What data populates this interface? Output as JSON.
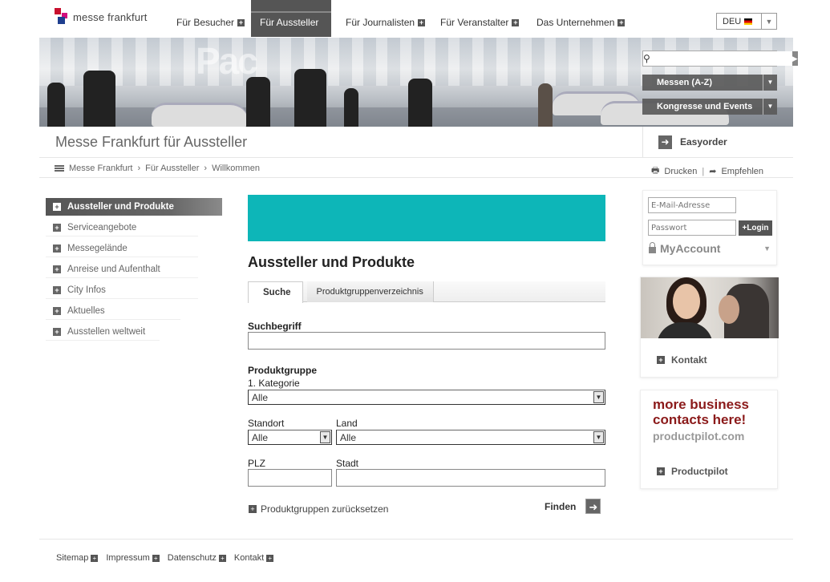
{
  "brand": {
    "name": "messe frankfurt"
  },
  "nav": {
    "items": [
      "Für Besucher",
      "Für Aussteller",
      "Für Journalisten",
      "Für Veranstalter",
      "Das Unternehmen"
    ],
    "active": "Für Aussteller"
  },
  "language": {
    "selected": "DEU"
  },
  "banner": {
    "text": "Pac",
    "search": {
      "placeholder": ""
    },
    "dropdowns": [
      "Messen (A-Z)",
      "Kongresse und Events"
    ]
  },
  "header": {
    "title": "Messe Frankfurt für Aussteller",
    "easyorder": "Easyorder"
  },
  "breadcrumb": [
    "Messe Frankfurt",
    "Für Aussteller",
    "Willkommen"
  ],
  "tools": {
    "print": "Drucken",
    "recommend": "Empfehlen"
  },
  "sidebar": {
    "items": [
      {
        "label": "Aussteller und Produkte",
        "active": true
      },
      {
        "label": "Serviceangebote"
      },
      {
        "label": "Messegelände"
      },
      {
        "label": "Anreise und Aufenthalt"
      },
      {
        "label": "City Infos"
      },
      {
        "label": "Aktuelles"
      },
      {
        "label": "Ausstellen weltweit"
      }
    ]
  },
  "main": {
    "accent_color": "#0db6b8",
    "title": "Aussteller und Produkte",
    "tabs": [
      "Suche",
      "Produktgruppenverzeichnis"
    ],
    "form": {
      "suchbegriff_label": "Suchbegriff",
      "produktgruppe_label": "Produktgruppe",
      "kategorie_label": "1. Kategorie",
      "kategorie_value": "Alle",
      "standort_label": "Standort",
      "standort_value": "Alle",
      "land_label": "Land",
      "land_value": "Alle",
      "plz_label": "PLZ",
      "stadt_label": "Stadt",
      "reset_label": "Produktgruppen zurücksetzen",
      "submit_label": "Finden"
    }
  },
  "login": {
    "email_placeholder": "E-Mail-Adresse",
    "password_placeholder": "Passwort",
    "login_label": "Login",
    "myaccount": "MyAccount"
  },
  "contact": {
    "label": "Kontakt"
  },
  "productpilot": {
    "line1": "more business",
    "line2": "contacts here!",
    "line3": "productpilot.com",
    "link": "Productpilot"
  },
  "footer": {
    "links": [
      "Sitemap",
      "Impressum",
      "Datenschutz",
      "Kontakt"
    ]
  }
}
